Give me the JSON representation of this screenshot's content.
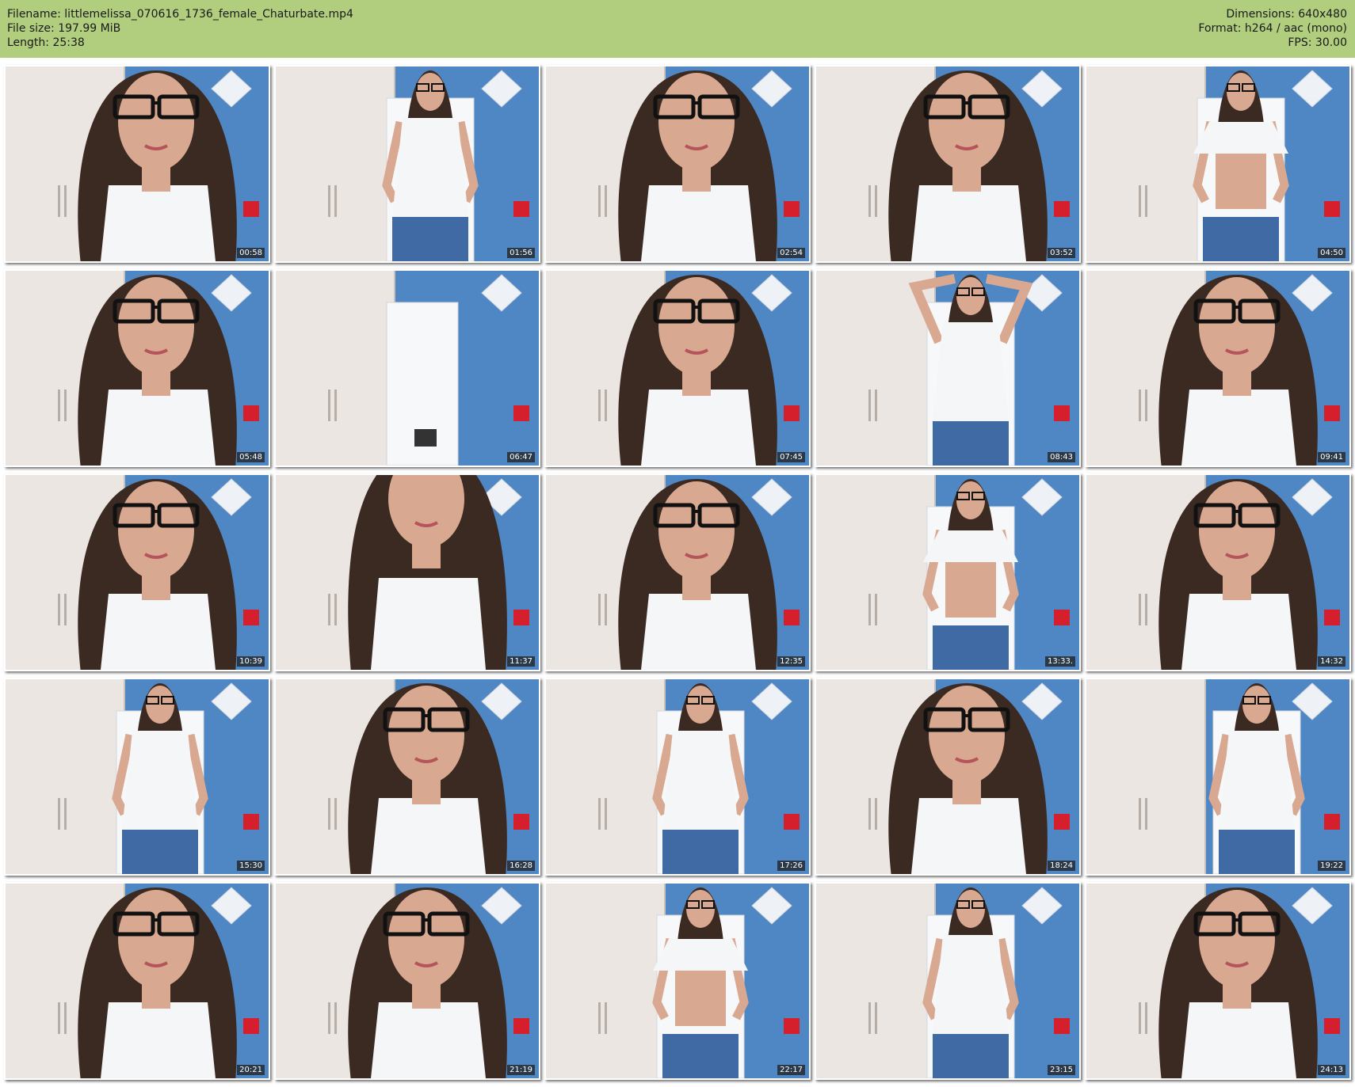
{
  "header": {
    "filename": "Filename: littlemelissa_070616_1736_female_Chaturbate.mp4",
    "filesize": "File size: 197.99 MiB",
    "length": "Length: 25:38",
    "dimensions": "Dimensions: 640x480",
    "format": "Format: h264 / aac (mono)",
    "fps": "FPS: 30.00"
  },
  "colors": {
    "header_bg": "#b1cd7e",
    "wall": "#e9e4e0",
    "blue_wall": "#4f86c4",
    "hair": "#3b2a22",
    "skin": "#d9a890",
    "shirt": "#f5f6f8",
    "jeans": "#3f6aa3"
  },
  "thumbnails": [
    {
      "time": "00:58",
      "scene": "closeup"
    },
    {
      "time": "01:56",
      "scene": "standing"
    },
    {
      "time": "02:54",
      "scene": "closeup"
    },
    {
      "time": "03:52",
      "scene": "closeup"
    },
    {
      "time": "04:50",
      "scene": "standing-lift"
    },
    {
      "time": "05:48",
      "scene": "closeup"
    },
    {
      "time": "06:47",
      "scene": "empty-room"
    },
    {
      "time": "07:45",
      "scene": "closeup"
    },
    {
      "time": "08:43",
      "scene": "standing-arms-up"
    },
    {
      "time": "09:41",
      "scene": "closeup"
    },
    {
      "time": "10:39",
      "scene": "closeup"
    },
    {
      "time": "11:37",
      "scene": "closeup-low"
    },
    {
      "time": "12:35",
      "scene": "closeup"
    },
    {
      "time": "13:33.",
      "scene": "standing-lift"
    },
    {
      "time": "14:32",
      "scene": "closeup"
    },
    {
      "time": "15:30",
      "scene": "standing"
    },
    {
      "time": "16:28",
      "scene": "closeup"
    },
    {
      "time": "17:26",
      "scene": "standing"
    },
    {
      "time": "18:24",
      "scene": "closeup"
    },
    {
      "time": "19:22",
      "scene": "standing-side"
    },
    {
      "time": "20:21",
      "scene": "closeup"
    },
    {
      "time": "21:19",
      "scene": "closeup"
    },
    {
      "time": "22:17",
      "scene": "standing-lift"
    },
    {
      "time": "23:15",
      "scene": "standing"
    },
    {
      "time": "24:13",
      "scene": "closeup"
    }
  ]
}
